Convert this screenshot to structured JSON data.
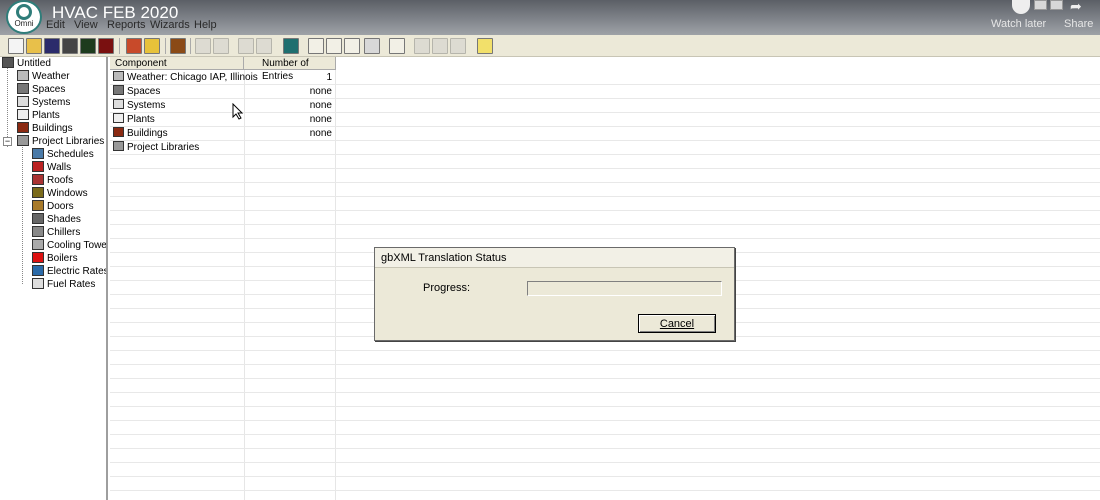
{
  "video": {
    "title": "HVAC FEB 2020",
    "channel_logo_text": "Omni",
    "watch_later": "Watch later",
    "share": "Share"
  },
  "menu": [
    "File",
    "Edit",
    "View",
    "Reports",
    "Wizards",
    "Help"
  ],
  "tree": {
    "root": "Untitled",
    "items": [
      {
        "label": "Weather",
        "icon": "weather-icon"
      },
      {
        "label": "Spaces",
        "icon": "spaces-icon"
      },
      {
        "label": "Systems",
        "icon": "systems-icon"
      },
      {
        "label": "Plants",
        "icon": "plants-icon"
      },
      {
        "label": "Buildings",
        "icon": "buildings-icon"
      },
      {
        "label": "Project Libraries",
        "icon": "library-icon"
      }
    ],
    "libraries": [
      {
        "label": "Schedules",
        "icon": "schedules-icon"
      },
      {
        "label": "Walls",
        "icon": "walls-icon"
      },
      {
        "label": "Roofs",
        "icon": "roofs-icon"
      },
      {
        "label": "Windows",
        "icon": "windows-icon"
      },
      {
        "label": "Doors",
        "icon": "doors-icon"
      },
      {
        "label": "Shades",
        "icon": "shades-icon"
      },
      {
        "label": "Chillers",
        "icon": "chillers-icon"
      },
      {
        "label": "Cooling Towers",
        "icon": "cooling-towers-icon"
      },
      {
        "label": "Boilers",
        "icon": "boilers-icon"
      },
      {
        "label": "Electric Rates",
        "icon": "electric-rates-icon"
      },
      {
        "label": "Fuel Rates",
        "icon": "fuel-rates-icon"
      }
    ]
  },
  "grid": {
    "columns": [
      "Component",
      "Number of Entries"
    ],
    "rows": [
      {
        "component": "Weather: Chicago IAP, Illinois",
        "entries": "1",
        "icon": "weather-icon"
      },
      {
        "component": "Spaces",
        "entries": "none",
        "icon": "spaces-icon"
      },
      {
        "component": "Systems",
        "entries": "none",
        "icon": "systems-icon"
      },
      {
        "component": "Plants",
        "entries": "none",
        "icon": "plants-icon"
      },
      {
        "component": "Buildings",
        "entries": "none",
        "icon": "buildings-icon"
      },
      {
        "component": "Project Libraries",
        "entries": "",
        "icon": "library-icon"
      }
    ]
  },
  "dialog": {
    "title": "gbXML Translation Status",
    "progress_label": "Progress:",
    "progress_value": 0,
    "cancel_label": "Cancel"
  },
  "colors": {
    "toolbar_bg": "#ece9d8",
    "progress_fill": "#3a6fd8"
  }
}
